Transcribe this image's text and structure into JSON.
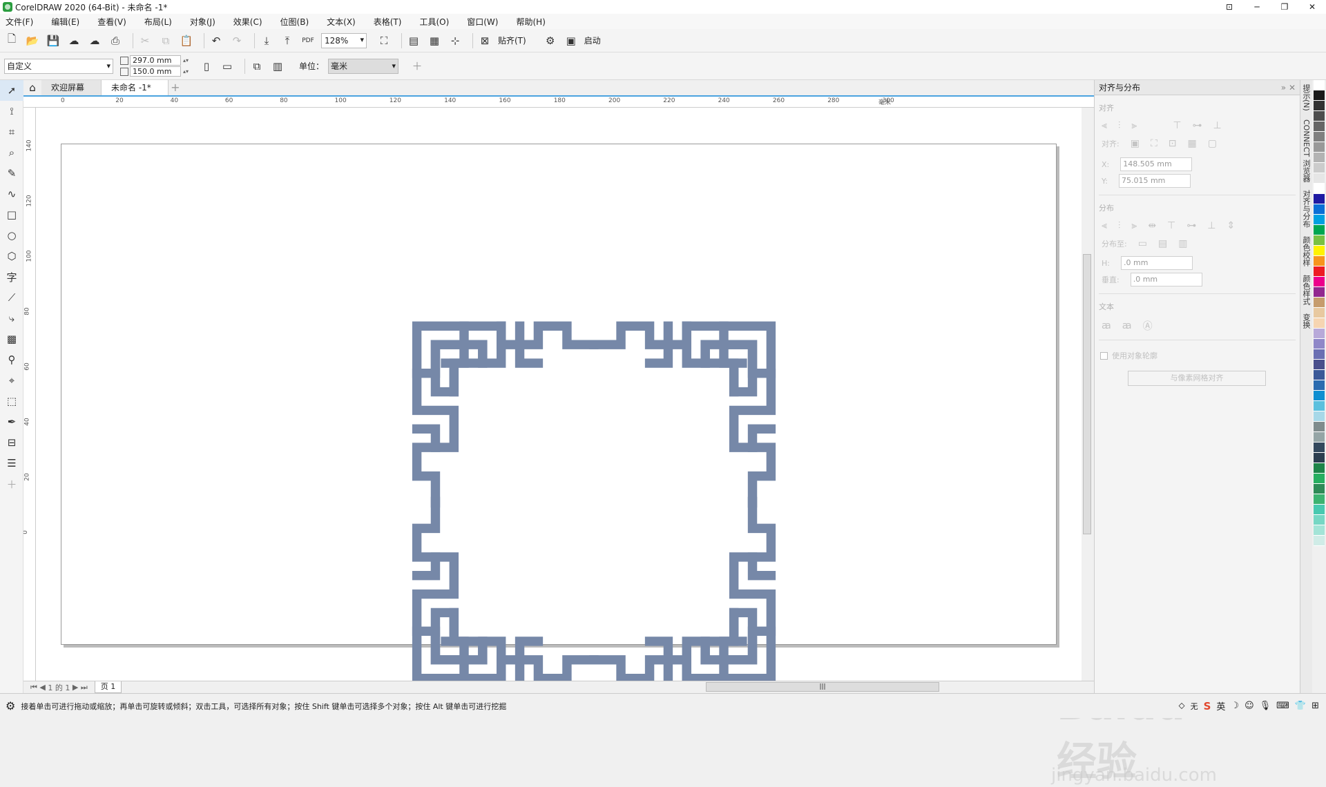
{
  "window": {
    "title": "CorelDRAW 2020 (64-Bit) - 未命名 -1*"
  },
  "menu": [
    "文件(F)",
    "编辑(E)",
    "查看(V)",
    "布局(L)",
    "对象(J)",
    "效果(C)",
    "位图(B)",
    "文本(X)",
    "表格(T)",
    "工具(O)",
    "窗口(W)",
    "帮助(H)"
  ],
  "toolbar": {
    "zoom": "128%",
    "snap_label": "贴齐(T)",
    "launch_label": "启动"
  },
  "property_bar": {
    "preset": "自定义",
    "width": "297.0 mm",
    "height": "150.0 mm",
    "unit_label": "单位：",
    "unit_value": "毫米"
  },
  "tabs": {
    "welcome": "欢迎屏幕",
    "document": "未命名 -1*"
  },
  "ruler_h": [
    "0",
    "20",
    "40",
    "60",
    "80",
    "100",
    "120",
    "140",
    "160",
    "180",
    "200",
    "220",
    "240",
    "260",
    "280",
    "300"
  ],
  "ruler_h_unit": "毫米",
  "ruler_v": [
    "140",
    "120",
    "100",
    "80",
    "60",
    "40",
    "20",
    "0"
  ],
  "page_nav": {
    "count": "1 的 1",
    "page_tab": "页 1"
  },
  "docker": {
    "title": "对齐与分布",
    "section_align": "对齐",
    "align_to_label": "对齐:",
    "x_label": "X:",
    "x_value": "148.505 mm",
    "y_label": "Y:",
    "y_value": "75.015 mm",
    "section_distribute": "分布",
    "distribute_to_label": "分布至:",
    "h_label": "H:",
    "h_value": ".0 mm",
    "v_label": "垂直:",
    "v_value": ".0 mm",
    "section_text": "文本",
    "use_outline_label": "使用对象轮廓",
    "pixel_grid_button": "与像素网格对齐"
  },
  "side_tabs": [
    "提示(N)",
    "CONNECT 浏览器",
    "对齐与分布",
    "颜色校样",
    "颜色样式",
    "变换"
  ],
  "palette": [
    "#ffffff",
    "#1a1a1a",
    "#333333",
    "#4d4d4d",
    "#666666",
    "#808080",
    "#999999",
    "#b3b3b3",
    "#cccccc",
    "#e6e6e6",
    "#ffffff",
    "#1f1aa3",
    "#0a6fd6",
    "#00a0e0",
    "#00a651",
    "#7ac143",
    "#fff200",
    "#f7941d",
    "#ed1c24",
    "#ec008c",
    "#92278f",
    "#c69c6d",
    "#e8c9a0",
    "#f6d5b2",
    "#b8a9d9",
    "#8f87c8",
    "#6b6fb3",
    "#4a4f8c",
    "#3b5998",
    "#2b6cb0",
    "#0f8fd1",
    "#5bc0de",
    "#a7d8e8",
    "#7f8c8d",
    "#95a5a6",
    "#34495e",
    "#2c3e50",
    "#1e8449",
    "#27ae60",
    "#2e8b57",
    "#3cb371",
    "#48c9b0",
    "#76d7c4",
    "#a3e4d7",
    "#d0ece7"
  ],
  "artwork": {
    "color": "#7688a8"
  },
  "status": {
    "hint": "接着单击可进行拖动或缩放；再单击可旋转或倾斜；双击工具，可选择所有对象；按住 Shift 键单击可选择多个对象；按住 Alt 键单击可进行挖掘",
    "fill": "无",
    "ime": "英"
  },
  "watermark": {
    "main": "Baidu经验",
    "sub": "jingyan.baidu.com"
  }
}
